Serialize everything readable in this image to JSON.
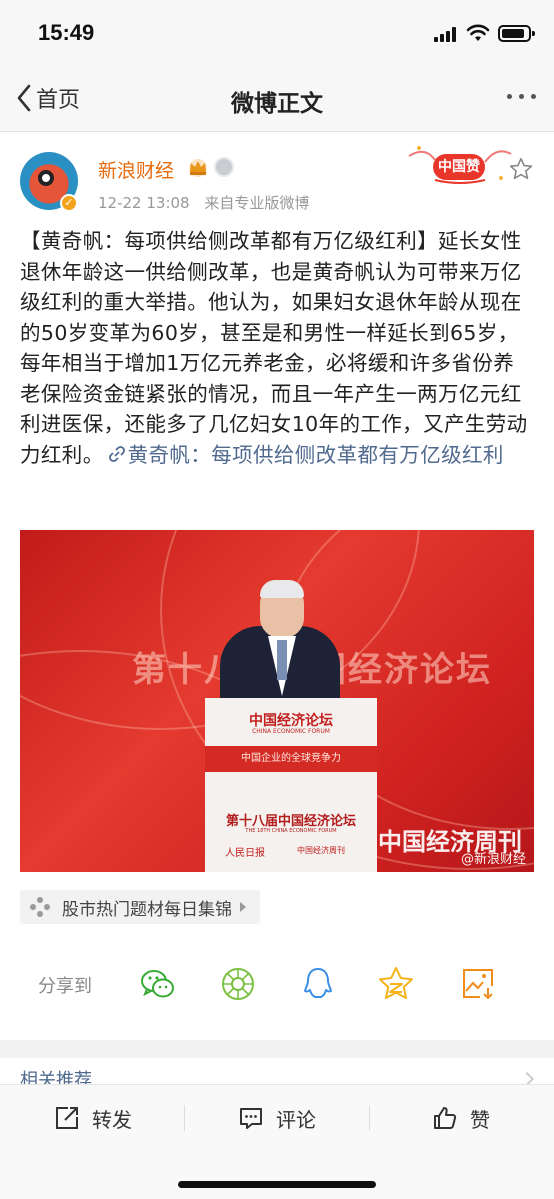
{
  "status_bar": {
    "time": "15:49",
    "icons": [
      "signal-icon",
      "wifi-icon",
      "battery-icon"
    ]
  },
  "nav": {
    "back_label": "首页",
    "title": "微博正文",
    "more_icon": "more-icon"
  },
  "post": {
    "account_name": "新浪财经",
    "badges": [
      "crown-icon",
      "medal-icon",
      "verified-icon"
    ],
    "time": "12-22 13:08",
    "source": "来自专业版微博",
    "promo_badge_text": "中国赞",
    "body_text": "【黄奇帆：每项供给侧改革都有万亿级红利】延长女性退休年龄这一供给侧改革，也是黄奇帆认为可带来万亿级红利的重大举措。他认为，如果妇女退休年龄从现在的50岁变革为60岁，甚至是和男性一样延长到65岁，每年相当于增加1万亿元养老金，必将缓和许多省份养老保险资金链紧张的情况，而且一年产生一两万亿元红利进医保，还能多了几亿妇女10年的工作，又产生劳动力红利。",
    "link_text": "黄奇帆：每项供给侧改革都有万亿级红利",
    "photo": {
      "banner_text": "第十八届中国经济论坛",
      "podium_logo": "中国经济论坛",
      "podium_subtitle": "CHINA ECONOMIC FORUM",
      "podium_band": "中国企业的全球竞争力",
      "podium_event": "第十八届中国经济论坛",
      "podium_event_en": "THE 18TH CHINA ECONOMIC FORUM",
      "podium_sponsor": "人民日报",
      "podium_sponsor2": "中国经济周刊",
      "publication": "中国经济周刊",
      "watermark": "@新浪财经"
    },
    "topic_tag": "股市热门题材每日集锦"
  },
  "share": {
    "label": "分享到",
    "targets": [
      "wechat-icon",
      "moments-icon",
      "qq-icon",
      "qzone-icon",
      "save-image-icon"
    ]
  },
  "related": {
    "title": "相关推荐"
  },
  "actions": {
    "repost": "转发",
    "comment": "评论",
    "like": "赞"
  },
  "colors": {
    "accent_orange": "#e86b0c",
    "link_blue": "#506a8f",
    "wechat_green": "#3aaa35",
    "moments_green": "#7cc143",
    "qq_blue": "#3a8ee6",
    "qzone_yellow": "#f5b21b",
    "save_orange": "#f08c1a"
  }
}
